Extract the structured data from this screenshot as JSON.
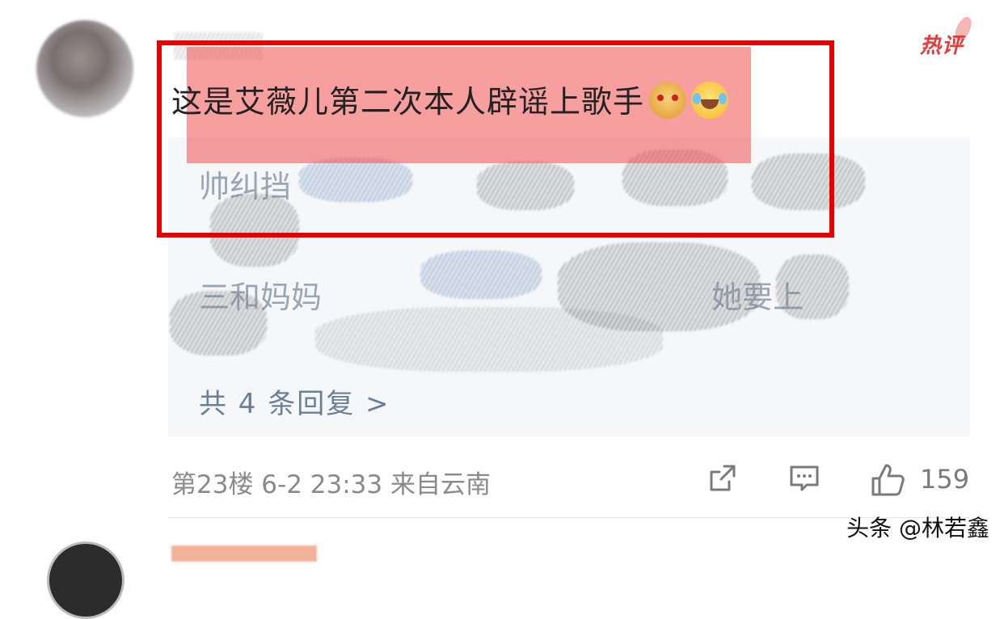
{
  "comment": {
    "badge": "热评",
    "text": "这是艾薇儿第二次本人辟谣上歌手",
    "emojis": [
      "doge-emoji",
      "laugh-cry-emoji"
    ]
  },
  "replies": {
    "line1": "帅纠挡",
    "line2": "三和妈妈",
    "line2_end": "她要上",
    "more_label": "共 4 条回复 >"
  },
  "footer": {
    "meta": "第23楼  6-2  23:33  来自云南",
    "like_count": "159"
  },
  "watermark": "头条 @林若鑫",
  "colors": {
    "highlight_box": "#e60000",
    "badge": "#e83a3a",
    "link": "#6b7f99"
  }
}
